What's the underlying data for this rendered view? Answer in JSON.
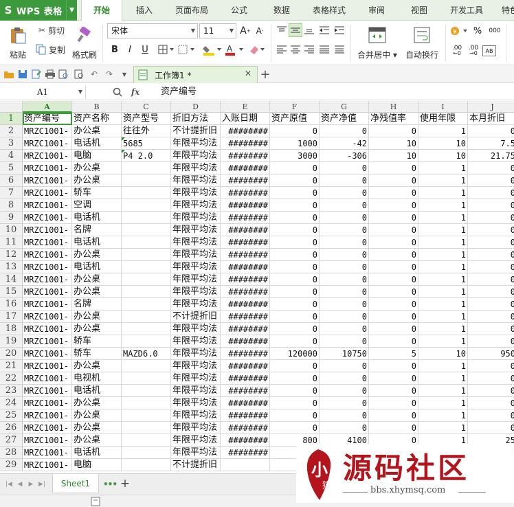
{
  "app": {
    "name": "WPS 表格",
    "logo": "S"
  },
  "menu_tabs": [
    "开始",
    "插入",
    "页面布局",
    "公式",
    "数据",
    "表格样式",
    "审阅",
    "视图",
    "开发工具",
    "特色"
  ],
  "ribbon": {
    "paste": "粘贴",
    "cut": "剪切",
    "copy": "复制",
    "format_painter": "格式刷",
    "font_name": "宋体",
    "font_size": "11",
    "grow_font": "A",
    "shrink_font": "A",
    "bold": "B",
    "italic": "I",
    "underline": "U",
    "merge_center": "合并居中",
    "wrap_text": "自动换行",
    "percent": "%",
    "thousands": "000",
    "number_format_preview": ".00"
  },
  "document": {
    "tab_title": "工作簿1 *"
  },
  "formula_bar": {
    "cell_ref": "A1",
    "fx": "fx",
    "value": "资产编号"
  },
  "columns": [
    "A",
    "B",
    "C",
    "D",
    "E",
    "F",
    "G",
    "H",
    "I",
    "J"
  ],
  "headers": [
    "资产编号",
    "资产名称",
    "资产型号",
    "折旧方法",
    "入账日期",
    "资产原值",
    "资产净值",
    "净残值率",
    "使用年限",
    "本月折旧"
  ],
  "rows": [
    [
      "MRZC1001-",
      "办公桌",
      "往往外",
      "不计提折旧",
      "########",
      "0",
      "0",
      "0",
      "1",
      "0"
    ],
    [
      "MRZC1001-",
      "电话机",
      "5685",
      "年限平均法",
      "########",
      "1000",
      "-42",
      "10",
      "10",
      "7.5"
    ],
    [
      "MRZC1001-",
      "电脑",
      "P4 2.0",
      "年限平均法",
      "########",
      "3000",
      "-306",
      "10",
      "10",
      "21.75"
    ],
    [
      "MRZC1001-",
      "办公桌",
      "",
      "年限平均法",
      "########",
      "0",
      "0",
      "0",
      "1",
      "0"
    ],
    [
      "MRZC1001-",
      "办公桌",
      "",
      "年限平均法",
      "########",
      "0",
      "0",
      "0",
      "1",
      "0"
    ],
    [
      "MRZC1001-",
      "轿车",
      "",
      "年限平均法",
      "########",
      "0",
      "0",
      "0",
      "1",
      "0"
    ],
    [
      "MRZC1001-",
      "空调",
      "",
      "年限平均法",
      "########",
      "0",
      "0",
      "0",
      "1",
      "0"
    ],
    [
      "MRZC1001-",
      "电话机",
      "",
      "年限平均法",
      "########",
      "0",
      "0",
      "0",
      "1",
      "0"
    ],
    [
      "MRZC1001-",
      "名牌",
      "",
      "年限平均法",
      "########",
      "0",
      "0",
      "0",
      "1",
      "0"
    ],
    [
      "MRZC1001-",
      "电话机",
      "",
      "年限平均法",
      "########",
      "0",
      "0",
      "0",
      "1",
      "0"
    ],
    [
      "MRZC1001-",
      "办公桌",
      "",
      "年限平均法",
      "########",
      "0",
      "0",
      "0",
      "1",
      "0"
    ],
    [
      "MRZC1001-",
      "电话机",
      "",
      "年限平均法",
      "########",
      "0",
      "0",
      "0",
      "1",
      "0"
    ],
    [
      "MRZC1001-",
      "办公桌",
      "",
      "年限平均法",
      "########",
      "0",
      "0",
      "0",
      "1",
      "0"
    ],
    [
      "MRZC1001-",
      "办公桌",
      "",
      "年限平均法",
      "########",
      "0",
      "0",
      "0",
      "1",
      "0"
    ],
    [
      "MRZC1001-",
      "名牌",
      "",
      "年限平均法",
      "########",
      "0",
      "0",
      "0",
      "1",
      "0"
    ],
    [
      "MRZC1001-",
      "办公桌",
      "",
      "不计提折旧",
      "########",
      "0",
      "0",
      "0",
      "1",
      "0"
    ],
    [
      "MRZC1001-",
      "办公桌",
      "",
      "年限平均法",
      "########",
      "0",
      "0",
      "0",
      "1",
      "0"
    ],
    [
      "MRZC1001-",
      "轿车",
      "",
      "年限平均法",
      "########",
      "0",
      "0",
      "0",
      "1",
      "0"
    ],
    [
      "MRZC1001-",
      "轿车",
      "MAZD6.0",
      "年限平均法",
      "########",
      "120000",
      "10750",
      "5",
      "10",
      "950"
    ],
    [
      "MRZC1001-",
      "办公桌",
      "",
      "年限平均法",
      "########",
      "0",
      "0",
      "0",
      "1",
      "0"
    ],
    [
      "MRZC1001-",
      "电视机",
      "",
      "年限平均法",
      "########",
      "0",
      "0",
      "0",
      "1",
      "0"
    ],
    [
      "MRZC1001-",
      "电话机",
      "",
      "年限平均法",
      "########",
      "0",
      "0",
      "0",
      "1",
      "0"
    ],
    [
      "MRZC1001-",
      "办公桌",
      "",
      "年限平均法",
      "########",
      "0",
      "0",
      "0",
      "1",
      "0"
    ],
    [
      "MRZC1001-",
      "办公桌",
      "",
      "年限平均法",
      "########",
      "0",
      "0",
      "0",
      "1",
      "0"
    ],
    [
      "MRZC1001-",
      "办公桌",
      "",
      "年限平均法",
      "########",
      "0",
      "0",
      "0",
      "1",
      "0"
    ],
    [
      "MRZC1001-",
      "办公桌",
      "",
      "年限平均法",
      "########",
      "800",
      "4100",
      "0",
      "1",
      "25"
    ],
    [
      "MRZC1001-",
      "电话机",
      "",
      "年限平均法",
      "########",
      "",
      "",
      "",
      "",
      "7"
    ],
    [
      "MRZC1001-",
      "电脑",
      "",
      "不计提折旧",
      "",
      "",
      "",
      "",
      "",
      ""
    ]
  ],
  "sheet": {
    "tab_name": "Sheet1"
  },
  "watermark": {
    "title": "源码社区",
    "url": "bbs.xhymsq.com",
    "seal": "小",
    "seal_small": "猿"
  },
  "colors": {
    "accent": "#3c9a3c",
    "watermark_red": "#b4141b"
  },
  "icons": [
    "paste-icon",
    "cut-icon",
    "copy-icon",
    "brush-icon",
    "borders-icon",
    "fill-color-icon",
    "font-color-icon",
    "clear-icon",
    "align-icons",
    "merge-icon",
    "wrap-icon",
    "currency-icon",
    "open-icon",
    "save-icon",
    "print-icon",
    "undo-icon",
    "redo-icon",
    "search-icon",
    "add-sheet-icon"
  ]
}
